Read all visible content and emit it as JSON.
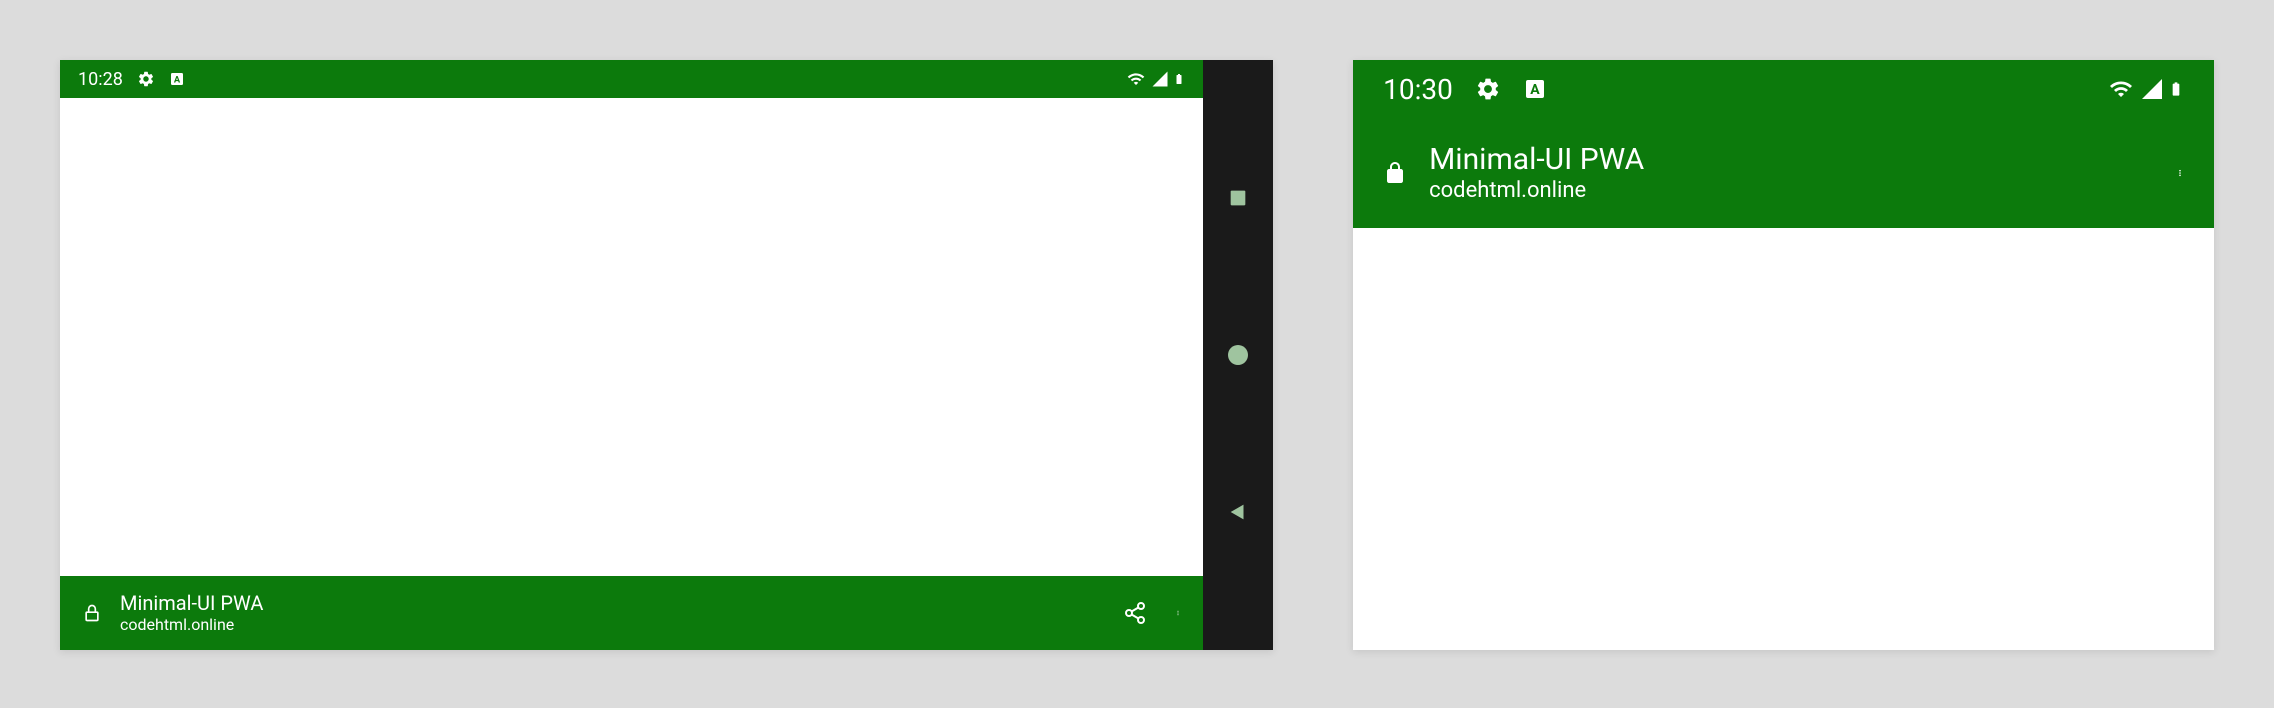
{
  "device_left": {
    "status_time": "10:28",
    "app_title": "Minimal-UI PWA",
    "app_url": "codehtml.online"
  },
  "device_right": {
    "status_time": "10:30",
    "app_title": "Minimal-UI PWA",
    "app_url": "codehtml.online"
  },
  "colors": {
    "brand_green": "#0c7a0c",
    "nav_dark": "#1a1a1a",
    "bg_grey": "#dcdcdc"
  }
}
